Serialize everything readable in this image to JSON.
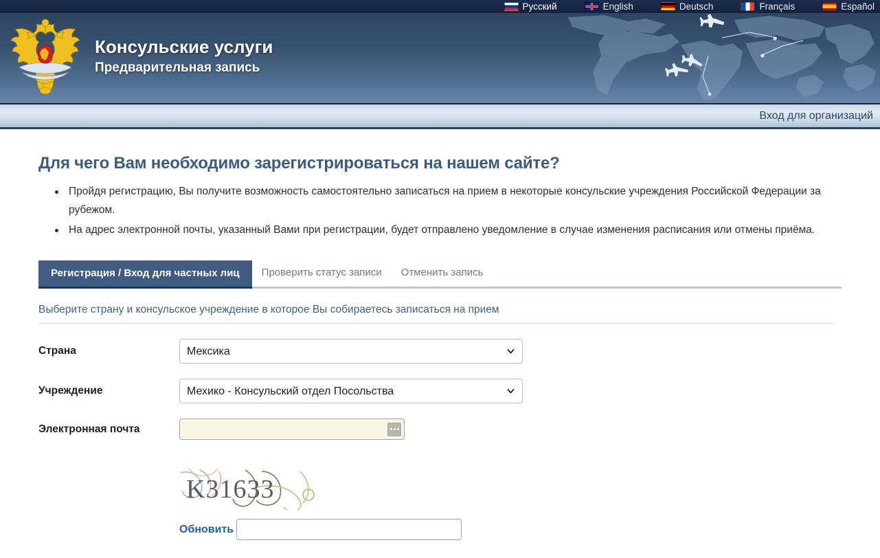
{
  "lang_bar": {
    "items": [
      {
        "label": "Русский",
        "flag": "flag-ru",
        "icon": "flag-russia-icon",
        "active": true
      },
      {
        "label": "English",
        "flag": "flag-gb",
        "icon": "flag-uk-icon",
        "active": false
      },
      {
        "label": "Deutsch",
        "flag": "flag-de",
        "icon": "flag-germany-icon",
        "active": false
      },
      {
        "label": "Français",
        "flag": "flag-fr",
        "icon": "flag-france-icon",
        "active": false
      },
      {
        "label": "Español",
        "flag": "flag-es",
        "icon": "flag-spain-icon",
        "active": false
      }
    ]
  },
  "header": {
    "emblem_icon": "russian-coat-of-arms-icon",
    "title": "Консульские услуги",
    "subtitle": "Предварительная запись",
    "background_icon": "world-map-airplanes-icon"
  },
  "org_strip": {
    "login_link": "Вход для организаций"
  },
  "main": {
    "page_title": "Для чего Вам необходимо зарегистрироваться на нашем сайте?",
    "bullets": [
      "Пройдя регистрацию, Вы получите возможность самостоятельно записаться на прием в некоторые консульские учреждения Российской Федерации за рубежом.",
      "На адрес электронной почты, указанный Вами при регистрации, будет отправлено уведомление в случае изменения расписания или отмены приёма."
    ],
    "tabs": [
      {
        "label": "Регистрация / Вход для частных лиц",
        "active": true
      },
      {
        "label": "Проверить статус записи",
        "active": false
      },
      {
        "label": "Отменить запись",
        "active": false
      }
    ],
    "form": {
      "hint": "Выберите страну и консульское учреждение в которое Вы собираетесь записаться на прием",
      "country": {
        "label": "Страна",
        "value": "Мексика",
        "options": [
          "Мексика"
        ]
      },
      "institution": {
        "label": "Учреждение",
        "value": "Мехико - Консульский отдел Посольства",
        "options": [
          "Мехико - Консульский отдел Посольства"
        ]
      },
      "email": {
        "label": "Электронная почта",
        "value": "",
        "placeholder": "",
        "autofill_icon": "three-dots-icon"
      },
      "captcha": {
        "code": "K31633",
        "refresh_label": "Обновить",
        "input_value": "",
        "input_placeholder": ""
      }
    }
  },
  "colors": {
    "header_top": "#2e4560",
    "header_bottom": "#6a86a9",
    "lang_bar": "#1d2c4d",
    "accent_tab": "#3f5c80",
    "title_blue": "#3c5b80",
    "link_blue": "#1f5fa8",
    "email_bg": "#f7f7e3"
  }
}
